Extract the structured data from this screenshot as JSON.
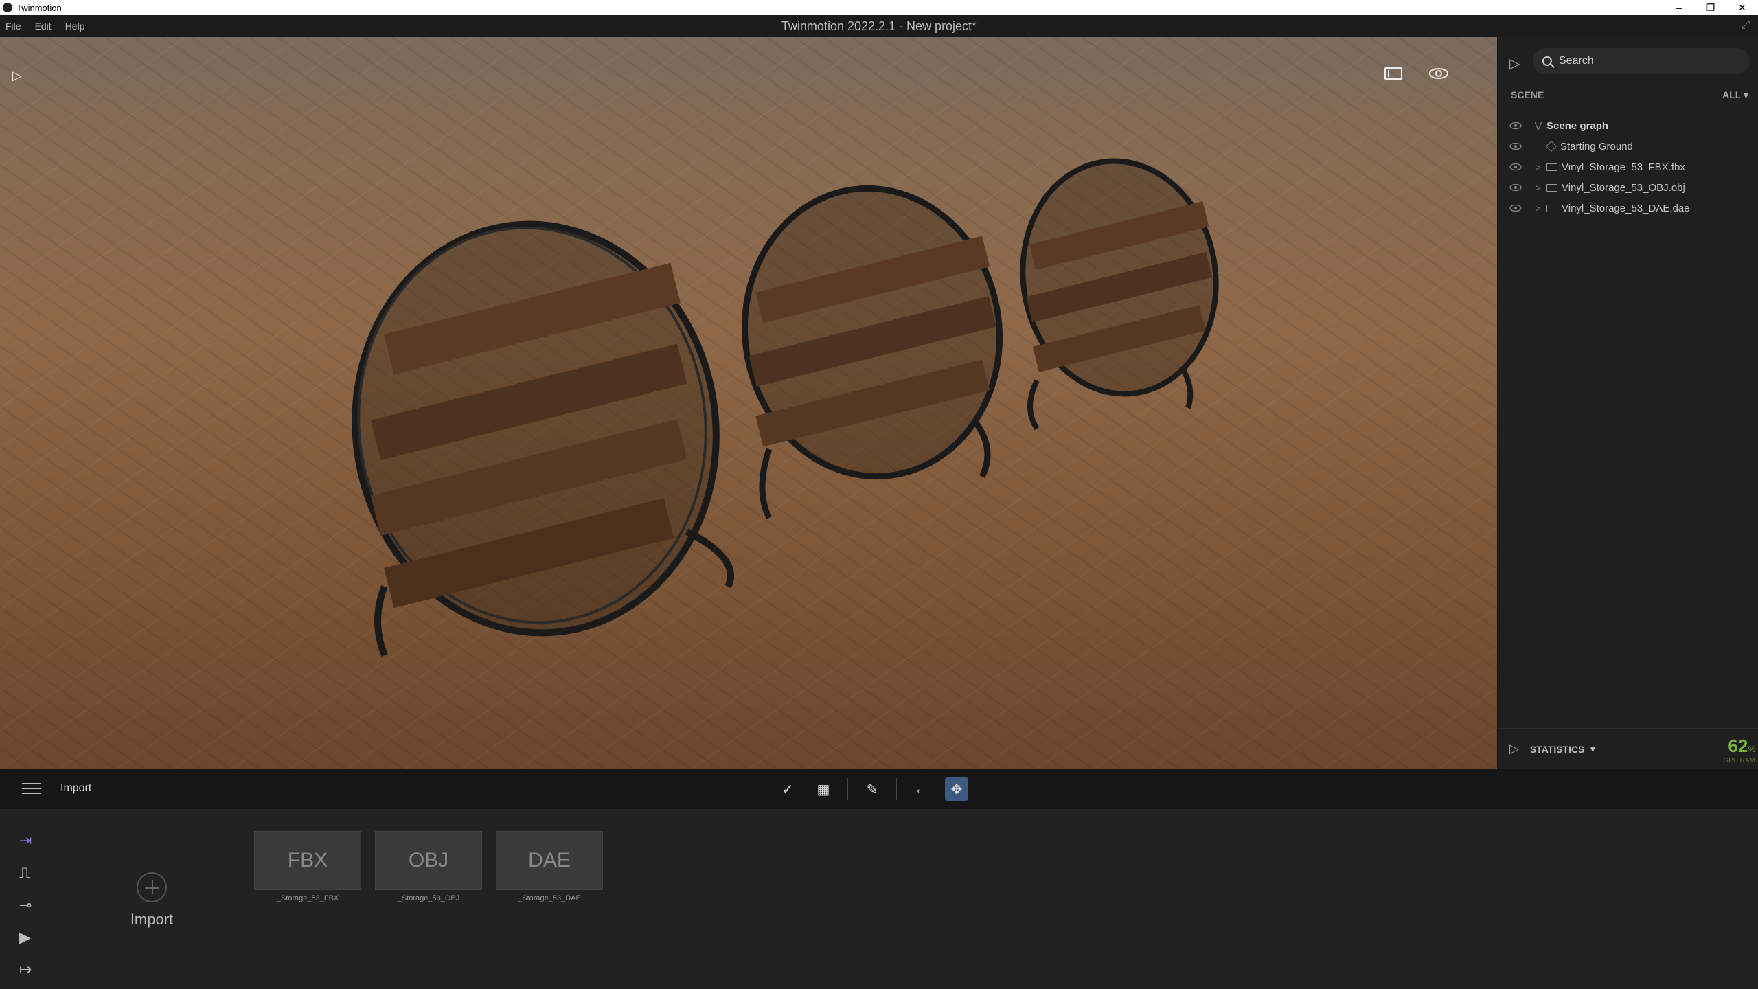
{
  "os_window": {
    "app_name": "Twinmotion",
    "controls": {
      "minimize": "–",
      "restore": "❐",
      "close": "✕"
    }
  },
  "menu": {
    "items": [
      "File",
      "Edit",
      "Help"
    ],
    "project_title": "Twinmotion 2022.2.1 - New project*",
    "fullscreen_icon": "⤢"
  },
  "viewport": {
    "play_icon": "▷"
  },
  "scene_panel": {
    "search_placeholder": "Search",
    "header": "SCENE",
    "filter": "ALL ▾",
    "tree": [
      {
        "label": "Scene graph",
        "kind": "root",
        "expand": "⋁"
      },
      {
        "label": "Starting Ground",
        "kind": "ground",
        "expand": ""
      },
      {
        "label": "Vinyl_Storage_53_FBX.fbx",
        "kind": "folder",
        "expand": ">"
      },
      {
        "label": "Vinyl_Storage_53_OBJ.obj",
        "kind": "folder",
        "expand": ">"
      },
      {
        "label": "Vinyl_Storage_53_DAE.dae",
        "kind": "folder",
        "expand": ">"
      }
    ],
    "statistics_label": "STATISTICS",
    "gpu_value": "62",
    "gpu_unit": "%",
    "gpu_label": "GPU RAM"
  },
  "toolbar": {
    "section_title": "Import",
    "tools": [
      {
        "name": "check-tool-icon",
        "glyph": "✓",
        "active": false
      },
      {
        "name": "grid-tool-icon",
        "glyph": "▦",
        "active": false
      },
      {
        "name": "picker-tool-icon",
        "glyph": "✎",
        "active": false
      },
      {
        "name": "back-tool-icon",
        "glyph": "←",
        "active": false
      },
      {
        "name": "move-tool-icon",
        "glyph": "✥",
        "active": true
      }
    ]
  },
  "bottom_panel": {
    "side_icons": [
      {
        "name": "import-mode-icon",
        "glyph": "⇥",
        "active": true
      },
      {
        "name": "context-mode-icon",
        "glyph": "⎍",
        "active": false
      },
      {
        "name": "configure-mode-icon",
        "glyph": "⊸",
        "active": false
      },
      {
        "name": "media-mode-icon",
        "glyph": "▶",
        "active": false
      },
      {
        "name": "export-mode-icon",
        "glyph": "↦",
        "active": false
      }
    ],
    "import_label": "Import",
    "assets": [
      {
        "thumb_label": "FBX",
        "name": "_Storage_53_FBX"
      },
      {
        "thumb_label": "OBJ",
        "name": "_Storage_53_OBJ"
      },
      {
        "thumb_label": "DAE",
        "name": "_Storage_53_DAE"
      }
    ]
  }
}
